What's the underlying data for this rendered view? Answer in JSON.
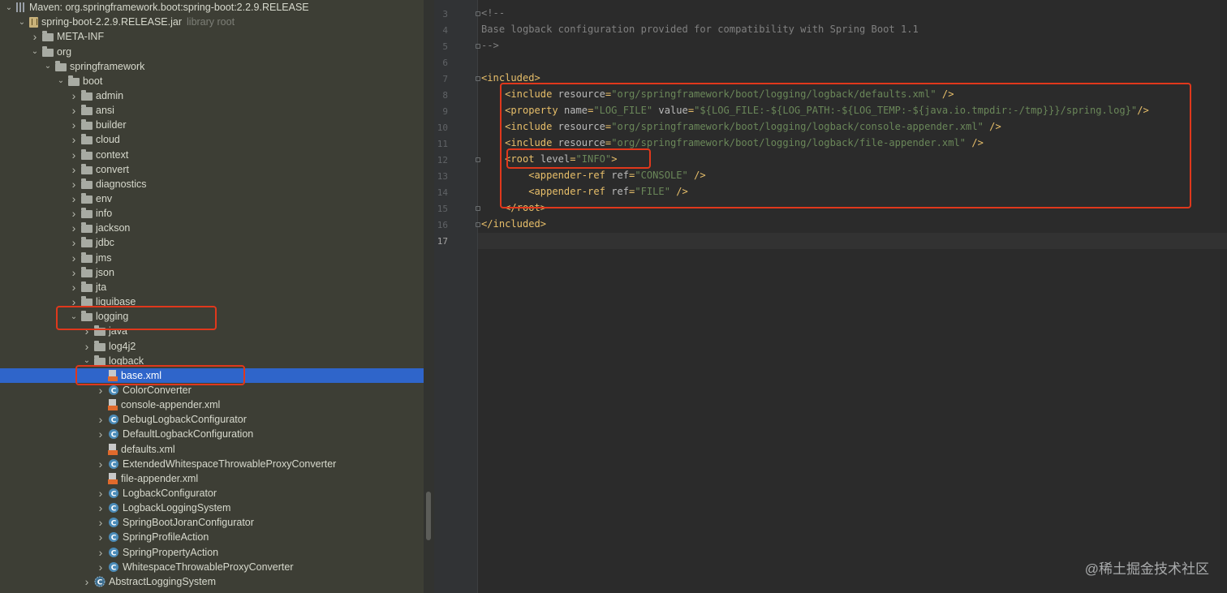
{
  "tree": {
    "rows": [
      {
        "label": "Maven: org.springframework.boot:spring-boot:2.2.9.RELEASE",
        "icon": "maven-icon",
        "arrow": "down"
      },
      {
        "label": "spring-boot-2.2.9.RELEASE.jar",
        "note": "library root",
        "icon": "jar-icon",
        "arrow": "down"
      },
      {
        "label": "META-INF",
        "icon": "folder-icon",
        "arrow": "right"
      },
      {
        "label": "org",
        "icon": "folder-icon",
        "arrow": "down"
      },
      {
        "label": "springframework",
        "icon": "folder-icon",
        "arrow": "down"
      },
      {
        "label": "boot",
        "icon": "folder-icon",
        "arrow": "down"
      },
      {
        "label": "admin",
        "icon": "folder-icon",
        "arrow": "right"
      },
      {
        "label": "ansi",
        "icon": "folder-icon",
        "arrow": "right"
      },
      {
        "label": "builder",
        "icon": "folder-icon",
        "arrow": "right"
      },
      {
        "label": "cloud",
        "icon": "folder-icon",
        "arrow": "right"
      },
      {
        "label": "context",
        "icon": "folder-icon",
        "arrow": "right"
      },
      {
        "label": "convert",
        "icon": "folder-icon",
        "arrow": "right"
      },
      {
        "label": "diagnostics",
        "icon": "folder-icon",
        "arrow": "right"
      },
      {
        "label": "env",
        "icon": "folder-icon",
        "arrow": "right"
      },
      {
        "label": "info",
        "icon": "folder-icon",
        "arrow": "right"
      },
      {
        "label": "jackson",
        "icon": "folder-icon",
        "arrow": "right"
      },
      {
        "label": "jdbc",
        "icon": "folder-icon",
        "arrow": "right"
      },
      {
        "label": "jms",
        "icon": "folder-icon",
        "arrow": "right"
      },
      {
        "label": "json",
        "icon": "folder-icon",
        "arrow": "right"
      },
      {
        "label": "jta",
        "icon": "folder-icon",
        "arrow": "right"
      },
      {
        "label": "liquibase",
        "icon": "folder-icon",
        "arrow": "right"
      },
      {
        "label": "logging",
        "icon": "folder-icon",
        "arrow": "down"
      },
      {
        "label": "java",
        "icon": "folder-icon",
        "arrow": "right"
      },
      {
        "label": "log4j2",
        "icon": "folder-icon",
        "arrow": "right"
      },
      {
        "label": "logback",
        "icon": "folder-icon",
        "arrow": "down"
      },
      {
        "label": "base.xml",
        "icon": "xml-file-icon",
        "arrow": "",
        "selected": true
      },
      {
        "label": "ColorConverter",
        "icon": "class-icon",
        "arrow": "right"
      },
      {
        "label": "console-appender.xml",
        "icon": "xml-file-icon",
        "arrow": ""
      },
      {
        "label": "DebugLogbackConfigurator",
        "icon": "class-icon",
        "arrow": "right"
      },
      {
        "label": "DefaultLogbackConfiguration",
        "icon": "class-icon",
        "arrow": "right"
      },
      {
        "label": "defaults.xml",
        "icon": "xml-file-icon",
        "arrow": ""
      },
      {
        "label": "ExtendedWhitespaceThrowableProxyConverter",
        "icon": "class-icon",
        "arrow": "right"
      },
      {
        "label": "file-appender.xml",
        "icon": "xml-file-icon",
        "arrow": ""
      },
      {
        "label": "LogbackConfigurator",
        "icon": "class-icon",
        "arrow": "right"
      },
      {
        "label": "LogbackLoggingSystem",
        "icon": "class-icon",
        "arrow": "right"
      },
      {
        "label": "SpringBootJoranConfigurator",
        "icon": "class-icon",
        "arrow": "right"
      },
      {
        "label": "SpringProfileAction",
        "icon": "class-icon",
        "arrow": "right"
      },
      {
        "label": "SpringPropertyAction",
        "icon": "class-icon",
        "arrow": "right"
      },
      {
        "label": "WhitespaceThrowableProxyConverter",
        "icon": "class-icon",
        "arrow": "right"
      },
      {
        "label": "AbstractLoggingSystem",
        "icon": "abstract-class-icon",
        "arrow": "right"
      }
    ]
  },
  "editor": {
    "lines": [
      {
        "n": "3",
        "tokens": [
          [
            "cm",
            "<!--"
          ]
        ]
      },
      {
        "n": "4",
        "tokens": [
          [
            "cm",
            "Base logback configuration provided for compatibility with Spring Boot 1.1"
          ]
        ]
      },
      {
        "n": "5",
        "tokens": [
          [
            "cm",
            "-->"
          ]
        ]
      },
      {
        "n": "6",
        "tokens": []
      },
      {
        "n": "7",
        "tokens": [
          [
            "tag",
            "<included>"
          ]
        ]
      },
      {
        "n": "8",
        "tokens": [
          [
            "txt",
            "    "
          ],
          [
            "tag",
            "<include "
          ],
          [
            "attr",
            "resource"
          ],
          [
            "tag",
            "="
          ],
          [
            "val",
            "\"org/springframework/boot/logging/logback/defaults.xml\""
          ],
          [
            "tag",
            " />"
          ]
        ]
      },
      {
        "n": "9",
        "tokens": [
          [
            "txt",
            "    "
          ],
          [
            "tag",
            "<property "
          ],
          [
            "attr",
            "name"
          ],
          [
            "tag",
            "="
          ],
          [
            "val",
            "\"LOG_FILE\""
          ],
          [
            "attr",
            " value"
          ],
          [
            "tag",
            "="
          ],
          [
            "val",
            "\"${LOG_FILE:-${LOG_PATH:-${LOG_TEMP:-${java.io.tmpdir:-/tmp}}}/spring.log}\""
          ],
          [
            "tag",
            "/>"
          ]
        ]
      },
      {
        "n": "10",
        "tokens": [
          [
            "txt",
            "    "
          ],
          [
            "tag",
            "<include "
          ],
          [
            "attr",
            "resource"
          ],
          [
            "tag",
            "="
          ],
          [
            "val",
            "\"org/springframework/boot/logging/logback/console-appender.xml\""
          ],
          [
            "tag",
            " />"
          ]
        ]
      },
      {
        "n": "11",
        "tokens": [
          [
            "txt",
            "    "
          ],
          [
            "tag",
            "<include "
          ],
          [
            "attr",
            "resource"
          ],
          [
            "tag",
            "="
          ],
          [
            "val",
            "\"org/springframework/boot/logging/logback/file-appender.xml\""
          ],
          [
            "tag",
            " />"
          ]
        ]
      },
      {
        "n": "12",
        "tokens": [
          [
            "txt",
            "    "
          ],
          [
            "tag",
            "<root "
          ],
          [
            "attr",
            "level"
          ],
          [
            "tag",
            "="
          ],
          [
            "val",
            "\"INFO\""
          ],
          [
            "tag",
            ">"
          ]
        ]
      },
      {
        "n": "13",
        "tokens": [
          [
            "txt",
            "        "
          ],
          [
            "tag",
            "<appender-ref "
          ],
          [
            "attr",
            "ref"
          ],
          [
            "tag",
            "="
          ],
          [
            "val",
            "\"CONSOLE\""
          ],
          [
            "tag",
            " />"
          ]
        ]
      },
      {
        "n": "14",
        "tokens": [
          [
            "txt",
            "        "
          ],
          [
            "tag",
            "<appender-ref "
          ],
          [
            "attr",
            "ref"
          ],
          [
            "tag",
            "="
          ],
          [
            "val",
            "\"FILE\""
          ],
          [
            "tag",
            " />"
          ]
        ]
      },
      {
        "n": "15",
        "tokens": [
          [
            "txt",
            "    "
          ],
          [
            "tag",
            "</root>"
          ]
        ]
      },
      {
        "n": "16",
        "tokens": [
          [
            "tag",
            "</included>"
          ]
        ]
      },
      {
        "n": "17",
        "tokens": [],
        "current": true
      }
    ]
  },
  "watermark": "@稀土掘金技术社区",
  "colors": {
    "highlight_box": "#e0381c",
    "selection": "#2f65ca",
    "tag": "#e8bf6a",
    "attribute": "#bababa",
    "string_value": "#6a8759",
    "comment": "#808080"
  }
}
